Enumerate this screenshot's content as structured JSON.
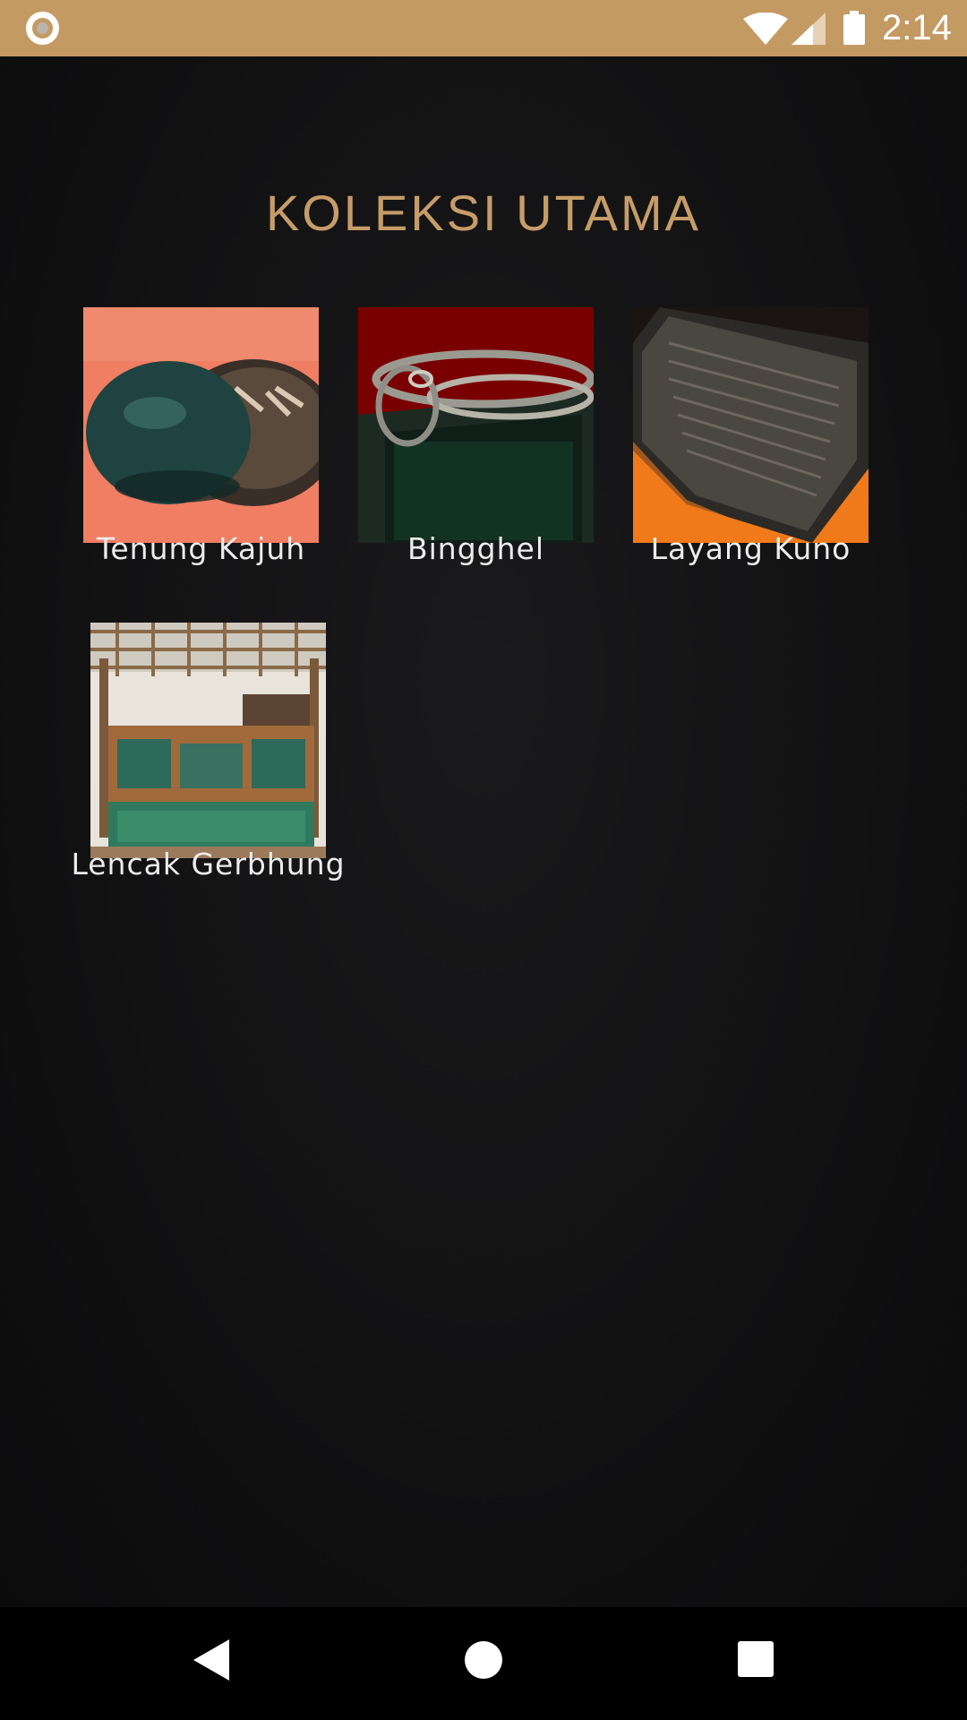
{
  "status_bar": {
    "time": "2:14",
    "background_color": "#c49a63",
    "icons": [
      "app-notification-icon",
      "wifi-icon",
      "signal-icon",
      "battery-icon"
    ]
  },
  "main": {
    "title": "KOLEKSI UTAMA",
    "title_color": "#c69c68",
    "items": [
      {
        "label": "Tenung Kajuh",
        "image": "tenung-kajuh-image"
      },
      {
        "label": "Bingghel",
        "image": "bingghel-image"
      },
      {
        "label": "Layang Kuno",
        "image": "layang-kuno-image"
      },
      {
        "label": "Lencak Gerbhung",
        "image": "lencak-gerbhung-image"
      }
    ]
  },
  "nav_bar": {
    "icons": [
      "back-icon",
      "home-icon",
      "recents-icon"
    ]
  }
}
